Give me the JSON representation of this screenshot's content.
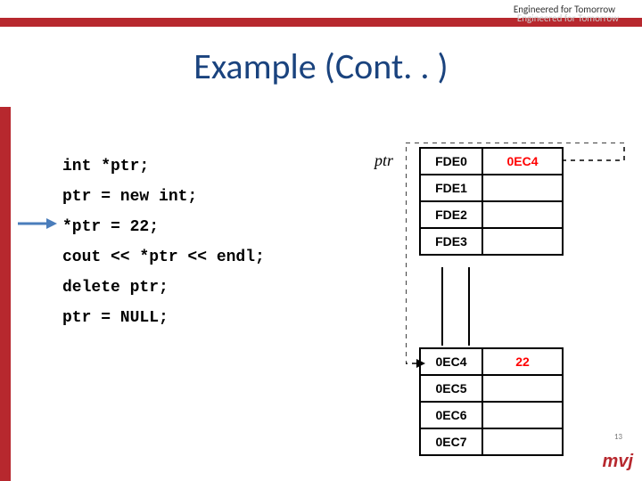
{
  "header": {
    "tagline": "Engineered for Tomorrow",
    "title": "Example (Cont. . )"
  },
  "code": {
    "l1": "int *ptr;",
    "l2": "ptr = new int;",
    "l3": "*ptr = 22;",
    "l4": "cout << *ptr << endl;",
    "l5": "delete ptr;",
    "l6": "ptr = NULL;"
  },
  "ptr_label": "ptr",
  "mem_top": {
    "rows": [
      {
        "addr": "FDE0",
        "val": "0EC4",
        "val_highlight": true
      },
      {
        "addr": "FDE1",
        "val": ""
      },
      {
        "addr": "FDE2",
        "val": ""
      },
      {
        "addr": "FDE3",
        "val": ""
      }
    ]
  },
  "mem_bottom": {
    "rows": [
      {
        "addr": "0EC4",
        "val": "22",
        "val_highlight": true
      },
      {
        "addr": "0EC5",
        "val": ""
      },
      {
        "addr": "0EC6",
        "val": ""
      },
      {
        "addr": "0EC7",
        "val": ""
      }
    ]
  },
  "footer": {
    "logo": "mvj",
    "page": "13"
  }
}
